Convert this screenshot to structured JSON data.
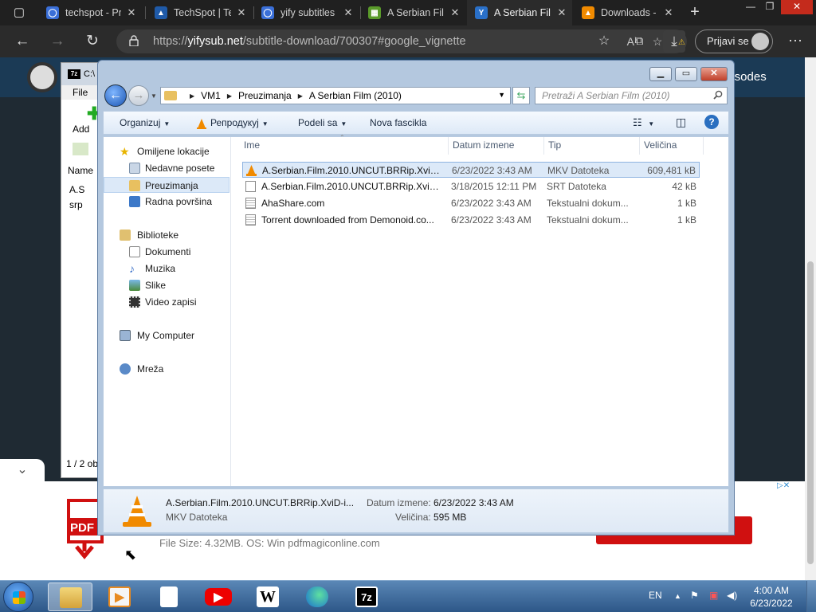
{
  "browser": {
    "tabs": [
      {
        "label": "techspot - Pr",
        "icon": "search-icon",
        "color": "#3a6fd8",
        "active": false
      },
      {
        "label": "TechSpot | Te",
        "icon": "techspot-icon",
        "color": "#1f5aa8",
        "active": false
      },
      {
        "label": "yify subtitles",
        "icon": "search-icon",
        "color": "#3a6fd8",
        "active": false
      },
      {
        "label": "A Serbian Fil",
        "icon": "yifysub-icon",
        "color": "#5a9a2a",
        "active": false
      },
      {
        "label": "A Serbian Fil",
        "icon": "ys-icon",
        "color": "#2a70c8",
        "active": true
      },
      {
        "label": "Downloads - ",
        "icon": "vlc-icon",
        "color": "#f08a00",
        "active": false
      }
    ],
    "url_prefix": "https://",
    "url_host": "yifysub.net",
    "url_path": "/subtitle-download/700307#google_vignette",
    "profile_label": "Prijavi se"
  },
  "page": {
    "nav_right": "pisodes",
    "ad_text": "File Size: 4.32MB. OS: Win pdfmagiconline.com",
    "ad_logo": "PDF"
  },
  "zip": {
    "title": "C:\\",
    "menu": "File",
    "add": "Add",
    "list_header": "Name",
    "items": [
      "A.S",
      "srp"
    ],
    "status": "1 / 2 ob"
  },
  "explorer": {
    "breadcrumbs": [
      "VM1",
      "Preuzimanja",
      "A Serbian Film (2010)"
    ],
    "search_placeholder": "Pretraži A Serbian Film (2010)",
    "commands": {
      "organize": "Organizuj",
      "play": "Репродукуј",
      "share": "Podeli sa",
      "new_folder": "Nova fascikla"
    },
    "nav": {
      "favorites": "Omiljene lokacije",
      "recent": "Nedavne posete",
      "downloads": "Preuzimanja",
      "desktop": "Radna površina",
      "libraries": "Biblioteke",
      "documents": "Dokumenti",
      "music": "Muzika",
      "pictures": "Slike",
      "videos": "Video zapisi",
      "computer": "My Computer",
      "network": "Mreža"
    },
    "columns": {
      "name": "Ime",
      "date": "Datum izmene",
      "type": "Tip",
      "size": "Veličina"
    },
    "files": [
      {
        "name": "A.Serbian.Film.2010.UNCUT.BRRip.XviD-i...",
        "date": "6/23/2022 3:43 AM",
        "type": "MKV Datoteka",
        "size": "609,481 kB",
        "icon": "vlc-file-icon",
        "selected": true
      },
      {
        "name": "A.Serbian.Film.2010.UNCUT.BRRip.XviD-i...",
        "date": "3/18/2015 12:11 PM",
        "type": "SRT Datoteka",
        "size": "42 kB",
        "icon": "srt-file-icon",
        "selected": false
      },
      {
        "name": "AhaShare.com",
        "date": "6/23/2022 3:43 AM",
        "type": "Tekstualni dokum...",
        "size": "1 kB",
        "icon": "text-file-icon",
        "selected": false
      },
      {
        "name": "Torrent downloaded from Demonoid.co...",
        "date": "6/23/2022 3:43 AM",
        "type": "Tekstualni dokum...",
        "size": "1 kB",
        "icon": "text-file-icon",
        "selected": false
      }
    ],
    "details": {
      "name": "A.Serbian.Film.2010.UNCUT.BRRip.XviD-i...",
      "type": "MKV Datoteka",
      "date_label": "Datum izmene:",
      "date_value": "6/23/2022 3:43 AM",
      "size_label": "Veličina:",
      "size_value": "595 MB"
    }
  },
  "taskbar": {
    "language": "EN",
    "time": "4:00 AM",
    "date": "6/23/2022",
    "zip_label": "7z",
    "wiki_label": "W"
  }
}
